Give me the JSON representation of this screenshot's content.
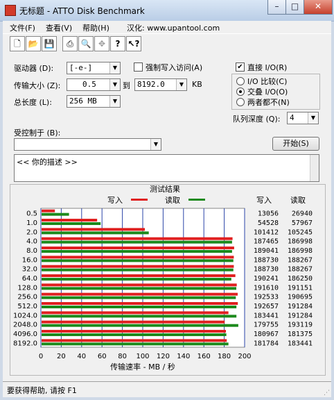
{
  "window": {
    "title": "无标题 - ATTO Disk Benchmark",
    "controls": {
      "minimize": "–",
      "maximize": "□",
      "close": "✕"
    }
  },
  "menu": [
    "文件(F)",
    "查看(V)",
    "帮助(H)",
    "汉化: www.upantool.com"
  ],
  "toolbar": [
    "new-icon",
    "open-icon",
    "save-icon",
    "print-icon",
    "print-preview-icon",
    "move-icon",
    "help-icon",
    "context-help-icon"
  ],
  "form": {
    "drive_label": "驱动器 (D):",
    "drive_value": "[-e-]",
    "force_write_label": "强制写入访问(A)",
    "force_write_checked": false,
    "transfer_label": "传输大小 (Z):",
    "transfer_from": "0.5",
    "to_label": "到",
    "transfer_to": "8192.0",
    "kb_label": "KB",
    "total_label": "总长度 (L):",
    "total_value": "256 MB",
    "direct_io_label": "直接 I/O(R)",
    "direct_io_checked": true,
    "io_compare_label": "I/O 比较(C)",
    "overlapped_label": "交叠 I/O(O)",
    "neither_label": "两者都不(N)",
    "selected_io_mode": "overlapped",
    "queue_label": "队列深度 (Q):",
    "queue_value": "4",
    "controlled_label": "受控制于 (B):",
    "controlled_value": "",
    "start_button": "开始(S)",
    "description": "<<  你的描述  >>"
  },
  "chart_data": {
    "type": "bar",
    "title": "测试结果",
    "legend": [
      {
        "name": "写入",
        "color": "#e02020"
      },
      {
        "name": "读取",
        "color": "#1c8a1c"
      }
    ],
    "legend_placement": "top-center",
    "xlabel": "传输速率 - MB / 秒",
    "xlim": [
      0,
      200
    ],
    "xticks": [
      0,
      20,
      40,
      60,
      80,
      100,
      120,
      140,
      160,
      180,
      200
    ],
    "grid": true,
    "categories": [
      "0.5",
      "1.0",
      "2.0",
      "4.0",
      "8.0",
      "16.0",
      "32.0",
      "64.0",
      "128.0",
      "256.0",
      "512.0",
      "1024.0",
      "2048.0",
      "4096.0",
      "8192.0"
    ],
    "table_headers": [
      "写入",
      "读取"
    ],
    "series": [
      {
        "name": "写入",
        "values": [
          13056,
          54528,
          101412,
          187465,
          189041,
          188730,
          188730,
          190241,
          191610,
          192533,
          192657,
          183441,
          179755,
          180967,
          181784
        ]
      },
      {
        "name": "读取",
        "values": [
          26940,
          57967,
          105245,
          186998,
          186998,
          188267,
          188267,
          186250,
          191151,
          190695,
          191284,
          191284,
          193119,
          181375,
          183441
        ]
      }
    ]
  },
  "status": "要获得帮助, 请按 F1"
}
